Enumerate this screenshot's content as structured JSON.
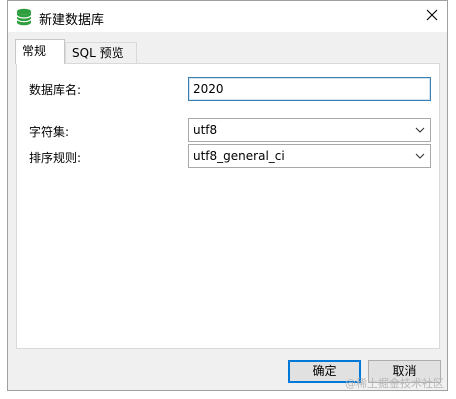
{
  "window": {
    "title": "新建数据库",
    "icon": "database-icon",
    "close_icon": "close-icon"
  },
  "tabs": [
    {
      "label": "常规",
      "active": true
    },
    {
      "label": "SQL 预览",
      "active": false
    }
  ],
  "form": {
    "db_name_label": "数据库名:",
    "db_name_value": "2020",
    "charset_label": "字符集:",
    "charset_value": "utf8",
    "collation_label": "排序规则:",
    "collation_value": "utf8_general_ci"
  },
  "buttons": {
    "ok_label": "确定",
    "cancel_label": "取消"
  },
  "watermark": "@稀土掘金技术社区",
  "colors": {
    "accent": "#0078d7",
    "icon_green": "#2e9e3e"
  }
}
